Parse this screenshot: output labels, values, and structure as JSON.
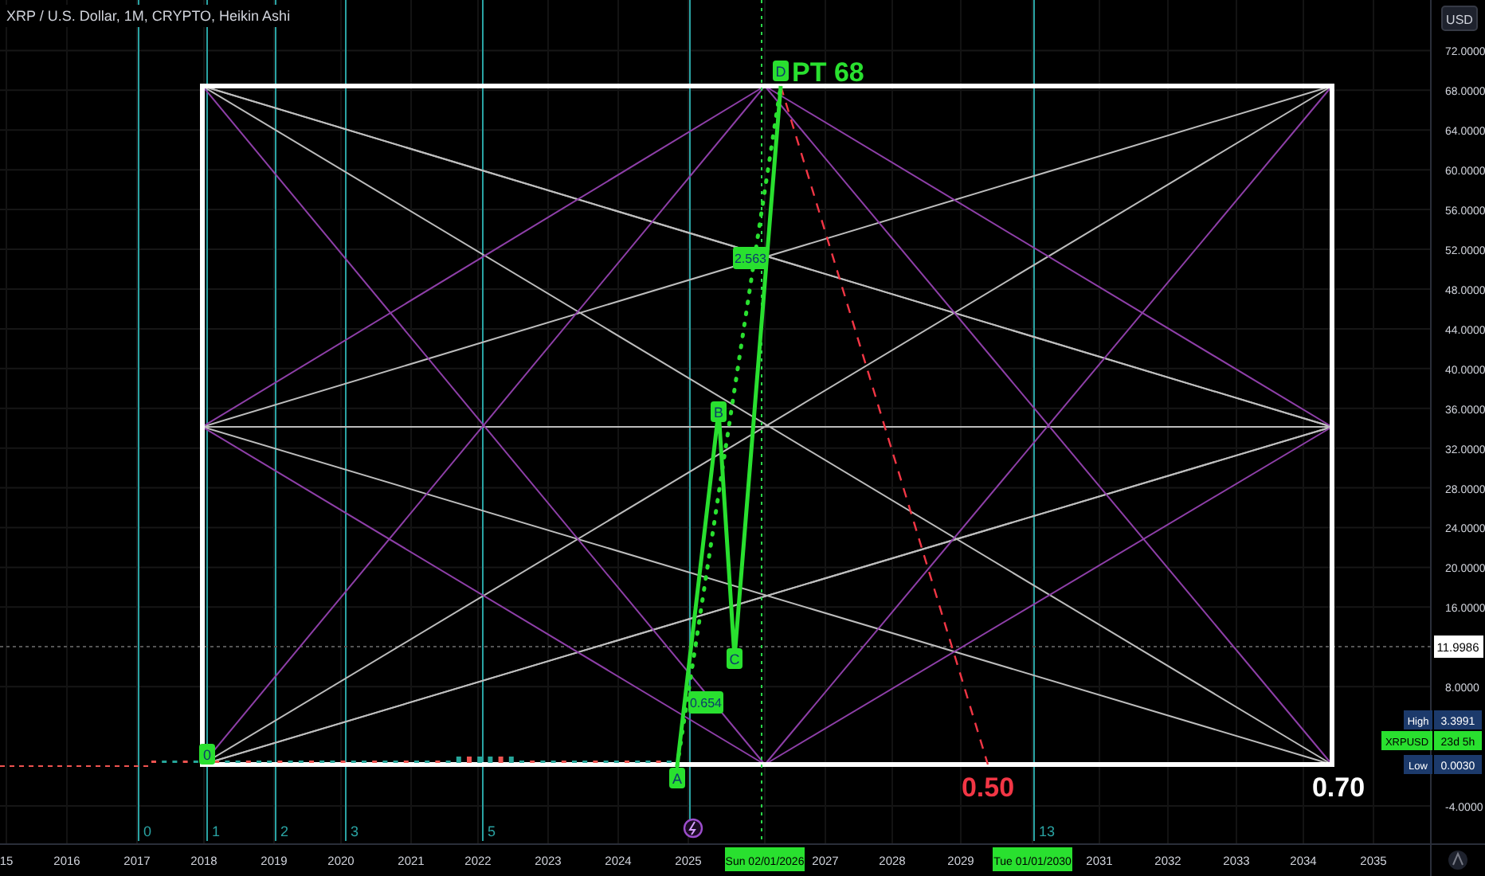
{
  "header": {
    "title": "XRP / U.S. Dollar, 1M, CRYPTO, Heikin Ashi"
  },
  "price_axis": {
    "currency_button": "USD",
    "ticks": [
      "72.0000",
      "68.0000",
      "64.0000",
      "60.0000",
      "56.0000",
      "52.0000",
      "48.0000",
      "44.0000",
      "40.0000",
      "36.0000",
      "32.0000",
      "28.0000",
      "24.0000",
      "20.0000",
      "16.0000",
      "8.0000",
      "-4.0000"
    ],
    "markers": [
      {
        "kind": "last",
        "value": "11.9986"
      },
      {
        "kind": "high",
        "label": "High",
        "value": "3.3991"
      },
      {
        "kind": "symbol",
        "label": "XRPUSD",
        "value": "23d 5h"
      },
      {
        "kind": "low",
        "label": "Low",
        "value": "0.0030"
      }
    ]
  },
  "time_axis": [
    {
      "label": "15",
      "highlighted": false
    },
    {
      "label": "2016",
      "highlighted": false
    },
    {
      "label": "2017",
      "highlighted": false
    },
    {
      "label": "2018",
      "highlighted": false
    },
    {
      "label": "2019",
      "highlighted": false
    },
    {
      "label": "2020",
      "highlighted": false
    },
    {
      "label": "2021",
      "highlighted": false
    },
    {
      "label": "2022",
      "highlighted": false
    },
    {
      "label": "2023",
      "highlighted": false
    },
    {
      "label": "2024",
      "highlighted": false
    },
    {
      "label": "2025",
      "highlighted": false
    },
    {
      "label": "Sun 02/01/2026",
      "highlighted": true
    },
    {
      "label": "2027",
      "highlighted": false
    },
    {
      "label": "2028",
      "highlighted": false
    },
    {
      "label": "2029",
      "highlighted": false
    },
    {
      "label": "Tue 01/01/2030",
      "highlighted": true
    },
    {
      "label": "2031",
      "highlighted": false
    },
    {
      "label": "2032",
      "highlighted": false
    },
    {
      "label": "2033",
      "highlighted": false
    },
    {
      "label": "2034",
      "highlighted": false
    },
    {
      "label": "2035",
      "highlighted": false
    }
  ],
  "fib_time_labels": [
    "0",
    "1",
    "2",
    "3",
    "5",
    "13"
  ],
  "wave_labels": [
    "0",
    "A",
    "B",
    "C",
    "D"
  ],
  "ratio_labels": [
    "0.654",
    "2.563"
  ],
  "targets": [
    {
      "kind": "top",
      "text": "PT 68"
    },
    {
      "kind": "low",
      "text": "0.50"
    },
    {
      "kind": "box",
      "text": "0.70"
    }
  ]
}
